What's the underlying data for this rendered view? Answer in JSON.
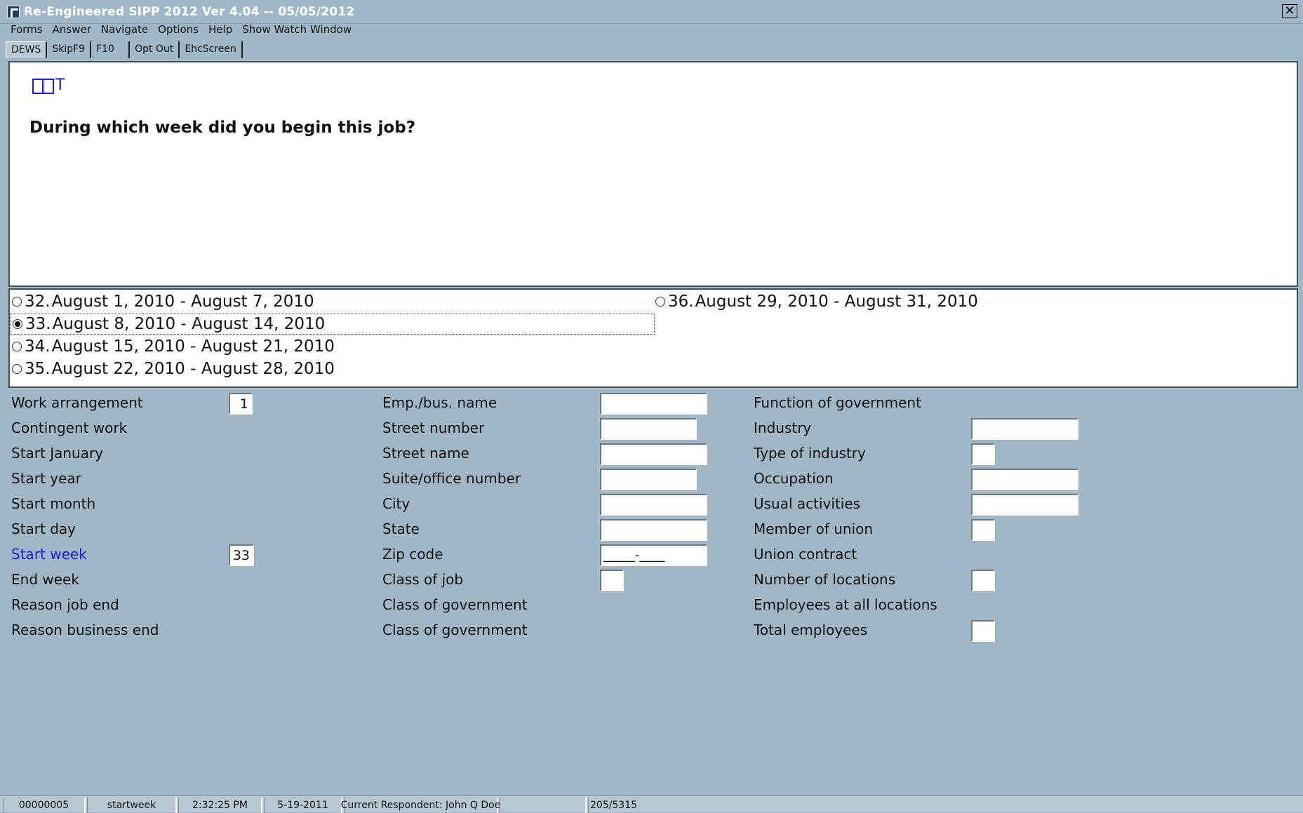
{
  "window": {
    "title": "Re-Engineered SIPP 2012 Ver 4.04 -- 05/05/2012",
    "close_label": "✕"
  },
  "menu": {
    "items": [
      "Forms",
      "Answer",
      "Navigate",
      "Options",
      "Help",
      "Show Watch Window"
    ]
  },
  "tabs": [
    "DEWS",
    "SkipF9",
    "F10",
    "Opt Out",
    "EhcScreen"
  ],
  "question": {
    "icon_t": "T",
    "text": "During which week did you begin this job?"
  },
  "answers": {
    "selected": "33",
    "options": [
      {
        "num": "32.",
        "text": "August  1, 2010 - August  7, 2010"
      },
      {
        "num": "33.",
        "text": "August  8, 2010 - August  14, 2010"
      },
      {
        "num": "34.",
        "text": "August  15, 2010 - August  21, 2010"
      },
      {
        "num": "35.",
        "text": "August  22, 2010 - August  28, 2010"
      },
      {
        "num": "36.",
        "text": "August  29, 2010 - August  31, 2010"
      }
    ]
  },
  "grid": {
    "col1": [
      {
        "label": "Work arrangement",
        "value": "1"
      },
      {
        "label": "Contingent work"
      },
      {
        "label": "Start January"
      },
      {
        "label": "Start year"
      },
      {
        "label": "Start month"
      },
      {
        "label": "Start day"
      },
      {
        "label": "Start week",
        "value": "33"
      },
      {
        "label": "End week"
      },
      {
        "label": "Reason job end"
      },
      {
        "label": "Reason business end"
      }
    ],
    "col2": [
      {
        "label": "Emp./bus. name",
        "value": ""
      },
      {
        "label": "Street number",
        "value": ""
      },
      {
        "label": "Street name",
        "value": ""
      },
      {
        "label": "Suite/office number",
        "value": ""
      },
      {
        "label": "City",
        "value": ""
      },
      {
        "label": "State",
        "value": ""
      },
      {
        "label": "Zip code",
        "value": "_____-____"
      },
      {
        "label": "Class of job",
        "value": ""
      },
      {
        "label": "Class of government"
      },
      {
        "label": "Class of government"
      }
    ],
    "col3": [
      {
        "label": "Function of government"
      },
      {
        "label": "Industry",
        "value": ""
      },
      {
        "label": "Type of industry",
        "value": ""
      },
      {
        "label": "Occupation",
        "value": ""
      },
      {
        "label": "Usual activities",
        "value": ""
      },
      {
        "label": "Member of union",
        "value": ""
      },
      {
        "label": "Union contract"
      },
      {
        "label": "Number of locations",
        "value": ""
      },
      {
        "label": "Employees at all locations"
      },
      {
        "label": "Total employees",
        "value": ""
      }
    ]
  },
  "status": {
    "case_id": "00000005",
    "field_name": "startweek",
    "time": "2:32:25 PM",
    "date": "5-19-2011",
    "respondent": "Current Respondent: John Q Doe",
    "blank": "",
    "progress": "205/5315"
  }
}
